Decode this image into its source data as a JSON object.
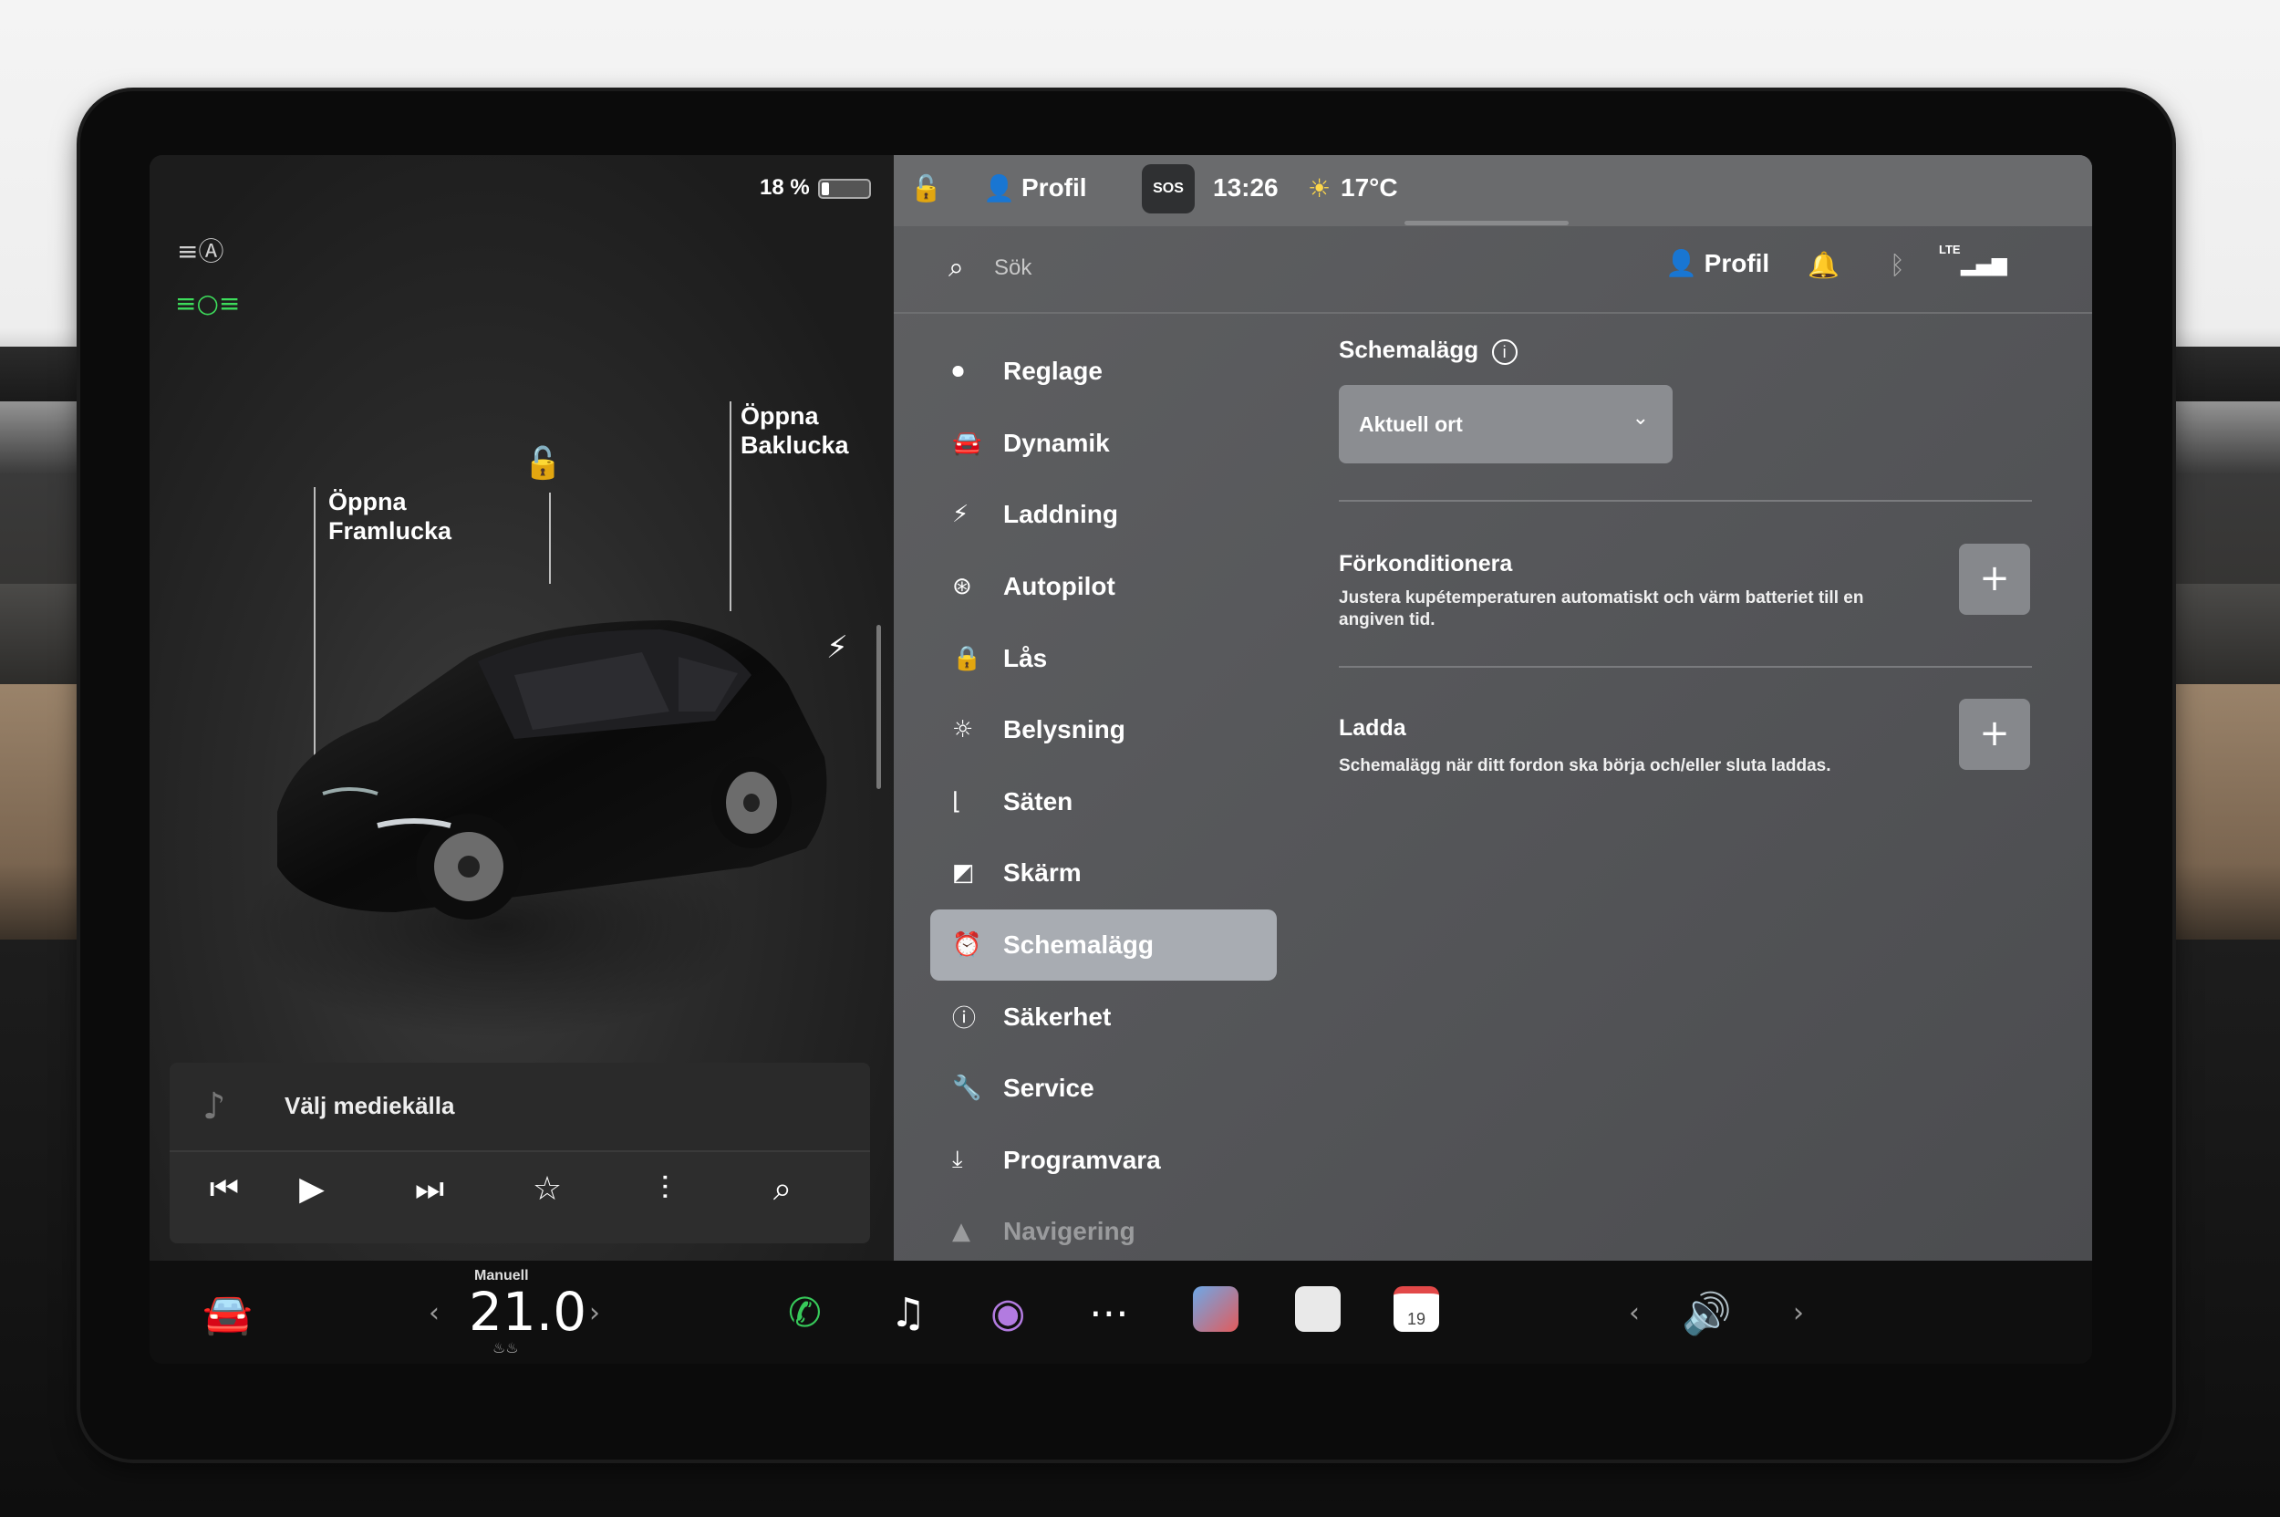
{
  "status": {
    "battery_percent": "18 %",
    "profile_label": "Profil",
    "sos_label": "SOS",
    "time": "13:26",
    "outside_temp": "17°C"
  },
  "car_panel": {
    "frunk_label_line1": "Öppna",
    "frunk_label_line2": "Framlucka",
    "trunk_label_line1": "Öppna",
    "trunk_label_line2": "Baklucka"
  },
  "media": {
    "source_label": "Välj mediekälla"
  },
  "search": {
    "placeholder": "Sök"
  },
  "header": {
    "profile_label": "Profil",
    "lte_label": "LTE"
  },
  "menu": [
    {
      "label": "Reglage",
      "icon": "toggle-icon"
    },
    {
      "label": "Dynamik",
      "icon": "car-icon"
    },
    {
      "label": "Laddning",
      "icon": "bolt-icon"
    },
    {
      "label": "Autopilot",
      "icon": "steering-wheel-icon"
    },
    {
      "label": "Lås",
      "icon": "lock-icon"
    },
    {
      "label": "Belysning",
      "icon": "light-icon"
    },
    {
      "label": "Säten",
      "icon": "seat-icon"
    },
    {
      "label": "Skärm",
      "icon": "display-icon"
    },
    {
      "label": "Schemalägg",
      "icon": "alarm-clock-icon",
      "active": true
    },
    {
      "label": "Säkerhet",
      "icon": "alert-icon"
    },
    {
      "label": "Service",
      "icon": "wrench-icon"
    },
    {
      "label": "Programvara",
      "icon": "download-icon"
    },
    {
      "label": "Navigering",
      "icon": "navigation-icon"
    }
  ],
  "schedule": {
    "title": "Schemalägg",
    "location_value": "Aktuell ort",
    "precondition_title": "Förkonditionera",
    "precondition_desc": "Justera kupétemperaturen automatiskt och värm batteriet till en angiven tid.",
    "charge_title": "Ladda",
    "charge_desc": "Schemalägg när ditt fordon ska börja och/eller sluta laddas."
  },
  "bottom_bar": {
    "climate_mode": "Manuell",
    "temperature": "21.0",
    "calendar_day": "19"
  },
  "colors": {
    "accent_green": "#3ddc5b",
    "active_menu_bg": "#a8acb2",
    "panel_bg": "#5a5b5e"
  }
}
